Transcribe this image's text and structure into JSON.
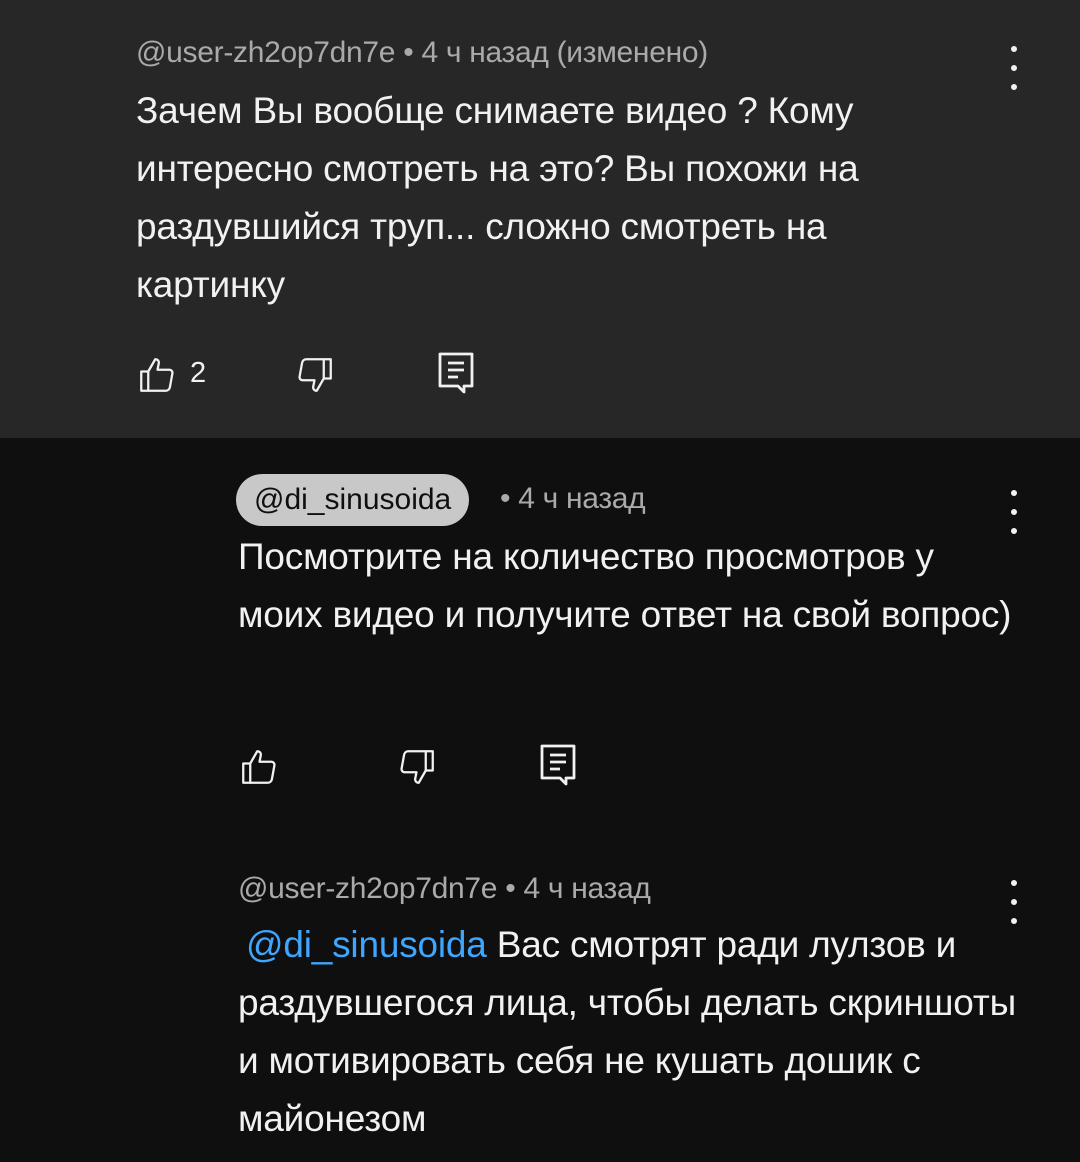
{
  "comments": [
    {
      "meta": "@user-zh2op7dn7e • 4 ч назад (изменено)",
      "text": "Зачем Вы вообще снимаете видео ? Кому интересно смотреть на это? Вы похожи на раздувшийся труп... сложно смотреть на картинку",
      "like_count": "2"
    },
    {
      "author": "@di_sinusoida",
      "time": "• 4 ч назад",
      "text": "Посмотрите на количество просмотров у моих видео и получите ответ на свой вопрос)"
    },
    {
      "meta": "@user-zh2op7dn7e • 4 ч назад",
      "mention": "@di_sinusoida",
      "text": " Вас смотрят ради лулзов и раздувшегося лица, чтобы делать скриншоты и мотивировать себя не кушать дошик с майонезом"
    }
  ],
  "icons": {
    "like": "thumbs-up-icon",
    "dislike": "thumbs-down-icon",
    "reply": "reply-icon",
    "menu": "more-vertical-icon"
  },
  "colors": {
    "background": "#0f0f0f",
    "highlight_background": "#272727",
    "mention": "#3ea6ff",
    "meta_text": "#aaaaaa",
    "author_chip": "#c8c8c8"
  }
}
